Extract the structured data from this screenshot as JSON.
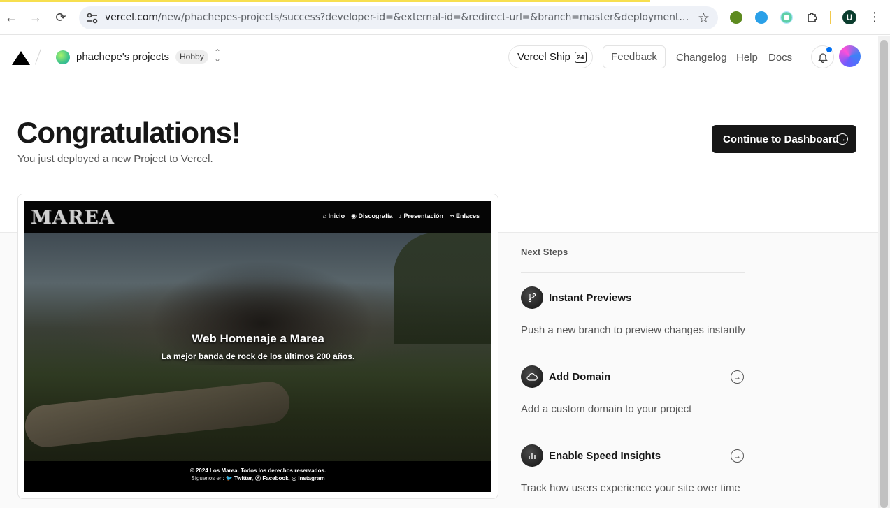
{
  "browser": {
    "url_host": "vercel.com",
    "url_rest": "/new/phachepes-projects/success?developer-id=&external-id=&redirect-url=&branch=master&deploymentUrl=homenaje...",
    "profile_initial": "U"
  },
  "header": {
    "team_name": "phachepe's projects",
    "plan_badge": "Hobby",
    "ship_label": "Vercel Ship",
    "ship_badge": "24",
    "feedback_label": "Feedback",
    "changelog_label": "Changelog",
    "help_label": "Help",
    "docs_label": "Docs"
  },
  "hero": {
    "title": "Congratulations!",
    "subtitle": "You just deployed a new Project to Vercel.",
    "dashboard_button": "Continue to Dashboard"
  },
  "preview": {
    "brand": "MAREA",
    "nav": [
      "Inicio",
      "Discografía",
      "Presentación",
      "Enlaces"
    ],
    "headline": "Web Homenaje a Marea",
    "tagline": "La mejor banda de rock de los últimos 200 años.",
    "copyright": "© 2024 Los Marea. Todos los derechos reservados.",
    "follow_prefix": "Síguenos en:",
    "social": [
      "Twitter",
      "Facebook",
      "Instagram"
    ]
  },
  "next_steps": {
    "label": "Next Steps",
    "items": [
      {
        "title": "Instant Previews",
        "description": "Push a new branch to preview changes instantly",
        "icon": "git-branch-icon"
      },
      {
        "title": "Add Domain",
        "description": "Add a custom domain to your project",
        "icon": "cloud-icon"
      },
      {
        "title": "Enable Speed Insights",
        "description": "Track how users experience your site over time",
        "icon": "bar-chart-icon"
      }
    ]
  },
  "colors": {
    "primary_button": "#171717",
    "notification_dot": "#0070f3",
    "loading_bar": "#f7df4f"
  }
}
